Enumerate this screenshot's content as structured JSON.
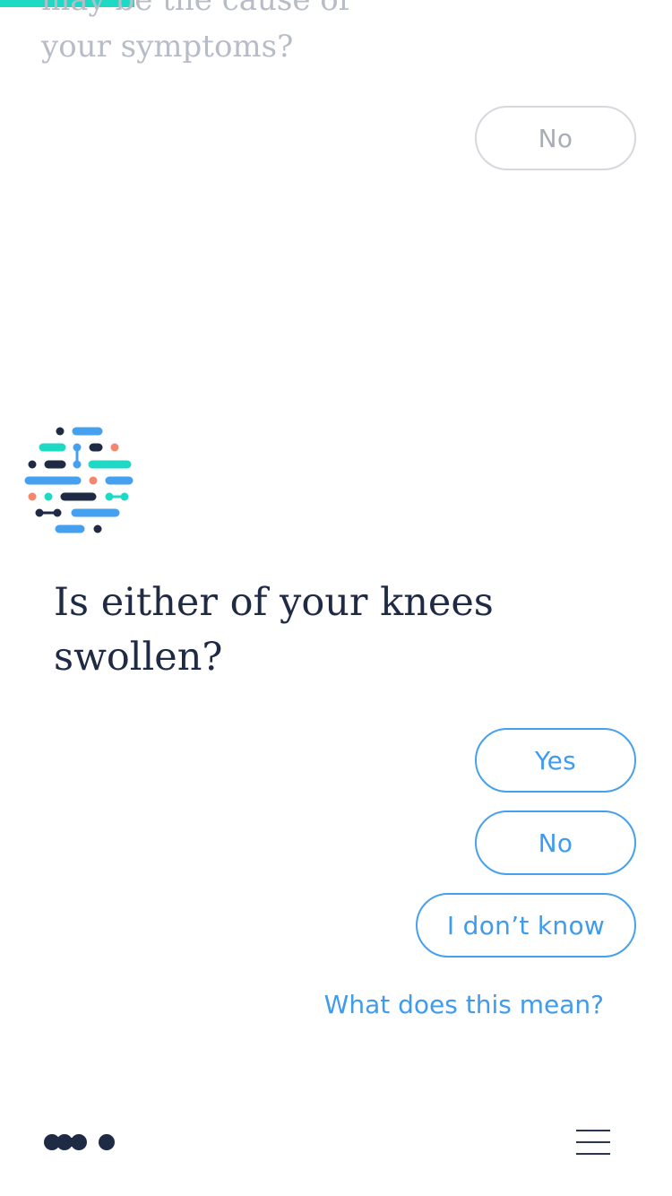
{
  "progress": {
    "fraction": 0.2
  },
  "previous": {
    "question_lines": [
      "may be the cause of",
      "your symptoms?"
    ],
    "answer_label": "No"
  },
  "logo_icon": "symptom-checker-logo",
  "current": {
    "question_lines": [
      "Is either of your knees",
      "swollen?"
    ],
    "answers": {
      "yes": "Yes",
      "no": "No",
      "dont_know": "I don’t know"
    },
    "explain_link": "What does this mean?"
  },
  "footer": {
    "logo_icon": "brand-mark-icon",
    "menu_icon": "hamburger-menu-icon"
  },
  "colors": {
    "accent_teal": "#1ed9c3",
    "accent_blue": "#46a0f0",
    "navy": "#1f2a44",
    "salmon": "#f2876e",
    "muted_gray": "#b7bcc6"
  }
}
